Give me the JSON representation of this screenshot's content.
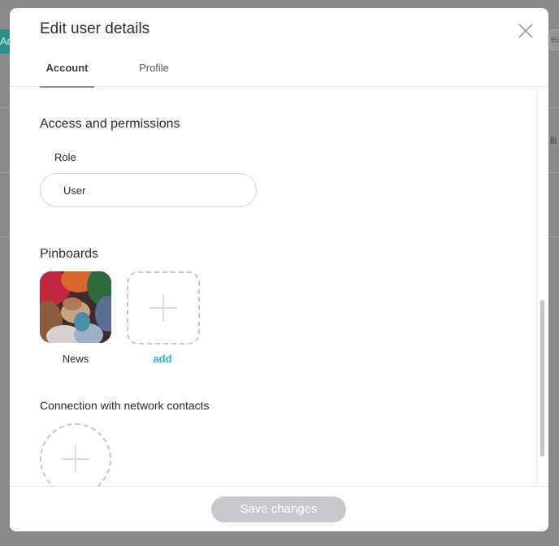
{
  "background": {
    "left_button_fragment": "Ad",
    "search_fragment": "ea",
    "row_text_fragment": "lli"
  },
  "modal": {
    "title": "Edit user details",
    "close_icon": "close-icon",
    "tabs": [
      {
        "label": "Account",
        "active": true
      },
      {
        "label": "Profile",
        "active": false
      }
    ]
  },
  "access": {
    "title": "Access and permissions",
    "role_label": "Role",
    "role_value": "User"
  },
  "pinboards": {
    "title": "Pinboards",
    "items": [
      {
        "label": "News"
      }
    ],
    "add_label": "add",
    "add_icon": "plus-icon"
  },
  "connections": {
    "title": "Connection with network contacts",
    "add_icon": "plus-icon"
  },
  "footer": {
    "save_label": "Save changes"
  },
  "colors": {
    "accent_link": "#20b3cf",
    "save_button_disabled": "#c6c8cb",
    "overlay": "#8a8a8a"
  }
}
